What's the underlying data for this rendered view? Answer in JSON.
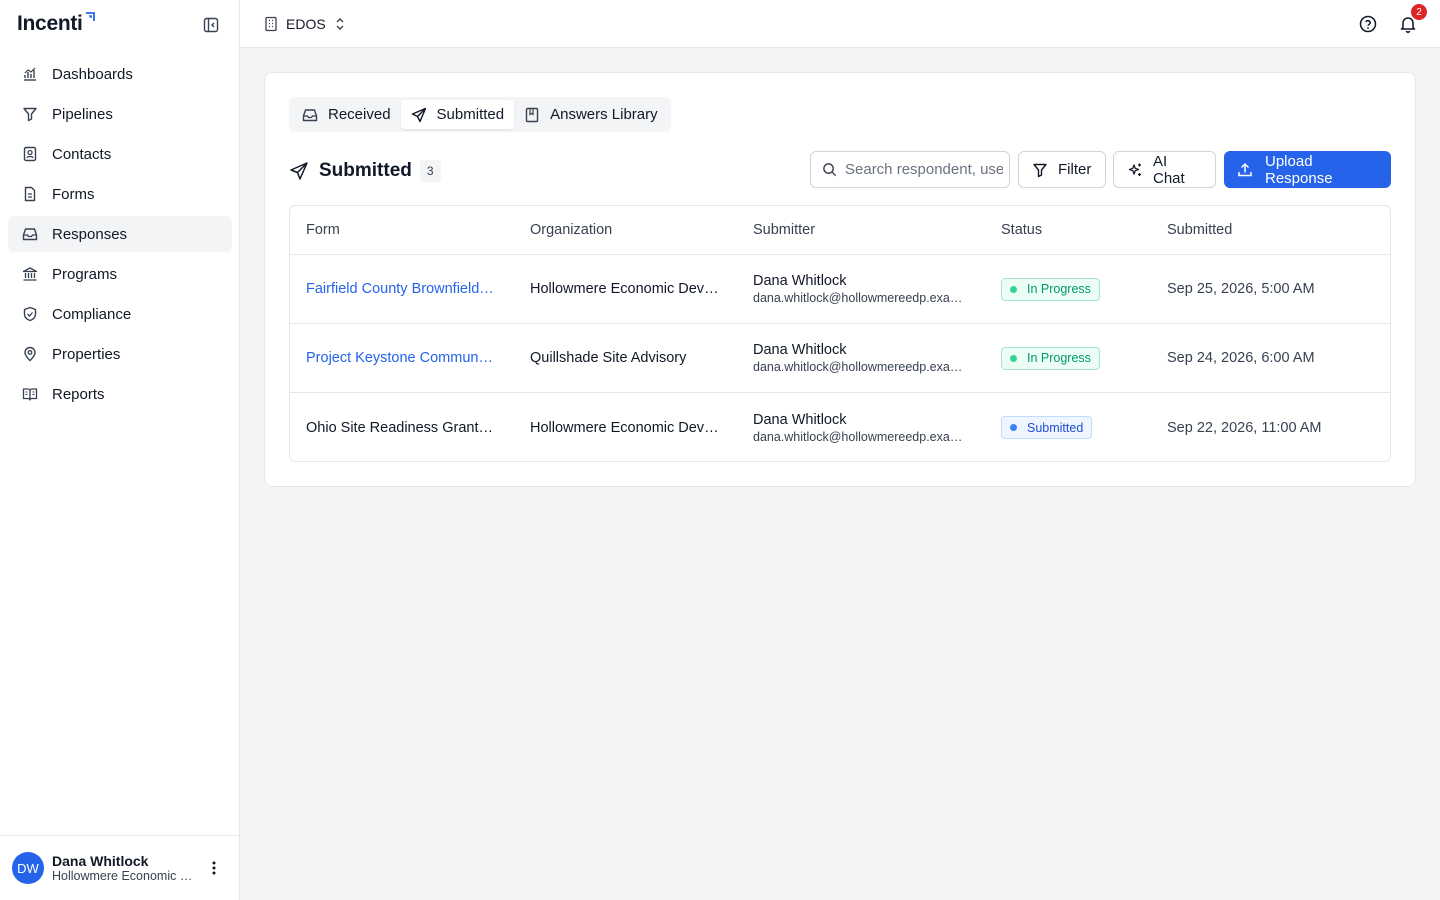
{
  "app": {
    "name": "Incenti"
  },
  "sidebar": {
    "items": [
      {
        "label": "Dashboards",
        "icon": "chart-icon"
      },
      {
        "label": "Pipelines",
        "icon": "funnel-icon"
      },
      {
        "label": "Contacts",
        "icon": "contact-book-icon"
      },
      {
        "label": "Forms",
        "icon": "document-icon"
      },
      {
        "label": "Responses",
        "icon": "inbox-icon",
        "active": true
      },
      {
        "label": "Programs",
        "icon": "bank-icon"
      },
      {
        "label": "Compliance",
        "icon": "shield-check-icon"
      },
      {
        "label": "Properties",
        "icon": "map-pin-icon"
      },
      {
        "label": "Reports",
        "icon": "book-open-icon"
      }
    ],
    "user": {
      "initials": "DW",
      "name": "Dana Whitlock",
      "org": "Hollowmere Economic Development Partnership"
    }
  },
  "topbar": {
    "workspace": "EDOS",
    "notification_count": "2"
  },
  "tabs": [
    {
      "label": "Received",
      "icon": "inbox-icon"
    },
    {
      "label": "Submitted",
      "icon": "send-icon",
      "active": true
    },
    {
      "label": "Answers Library",
      "icon": "book-icon"
    }
  ],
  "section": {
    "title": "Submitted",
    "count": "3"
  },
  "search": {
    "placeholder": "Search respondent, user..."
  },
  "toolbar": {
    "filter_label": "Filter",
    "ai_label": "AI Chat",
    "upload_label": "Upload Response"
  },
  "table": {
    "headers": [
      "Form",
      "Organization",
      "Submitter",
      "Status",
      "Submitted"
    ],
    "rows": [
      {
        "form": "Fairfield County Brownfield Redevelopment Application",
        "form_link": true,
        "organization": "Hollowmere Economic Development Partnership",
        "submitter_name": "Dana Whitlock",
        "submitter_email": "dana.whitlock@hollowmereedp.example.com",
        "status": "In Progress",
        "submitted": "Sep 25, 2026, 5:00 AM"
      },
      {
        "form": "Project Keystone Community Impact Survey",
        "form_link": true,
        "organization": "Quillshade Site Advisory",
        "submitter_name": "Dana Whitlock",
        "submitter_email": "dana.whitlock@hollowmereedp.example.com",
        "status": "In Progress",
        "submitted": "Sep 24, 2026, 6:00 AM"
      },
      {
        "form": "Ohio Site Readiness Grant Application",
        "form_link": false,
        "organization": "Hollowmere Economic Development Partnership",
        "submitter_name": "Dana Whitlock",
        "submitter_email": "dana.whitlock@hollowmereedp.example.com",
        "status": "Submitted",
        "submitted": "Sep 22, 2026, 11:00 AM"
      }
    ]
  },
  "colors": {
    "accent": "#2563eb",
    "in_progress": "#059669",
    "submitted": "#1d4ed8",
    "badge": "#dc2626"
  }
}
